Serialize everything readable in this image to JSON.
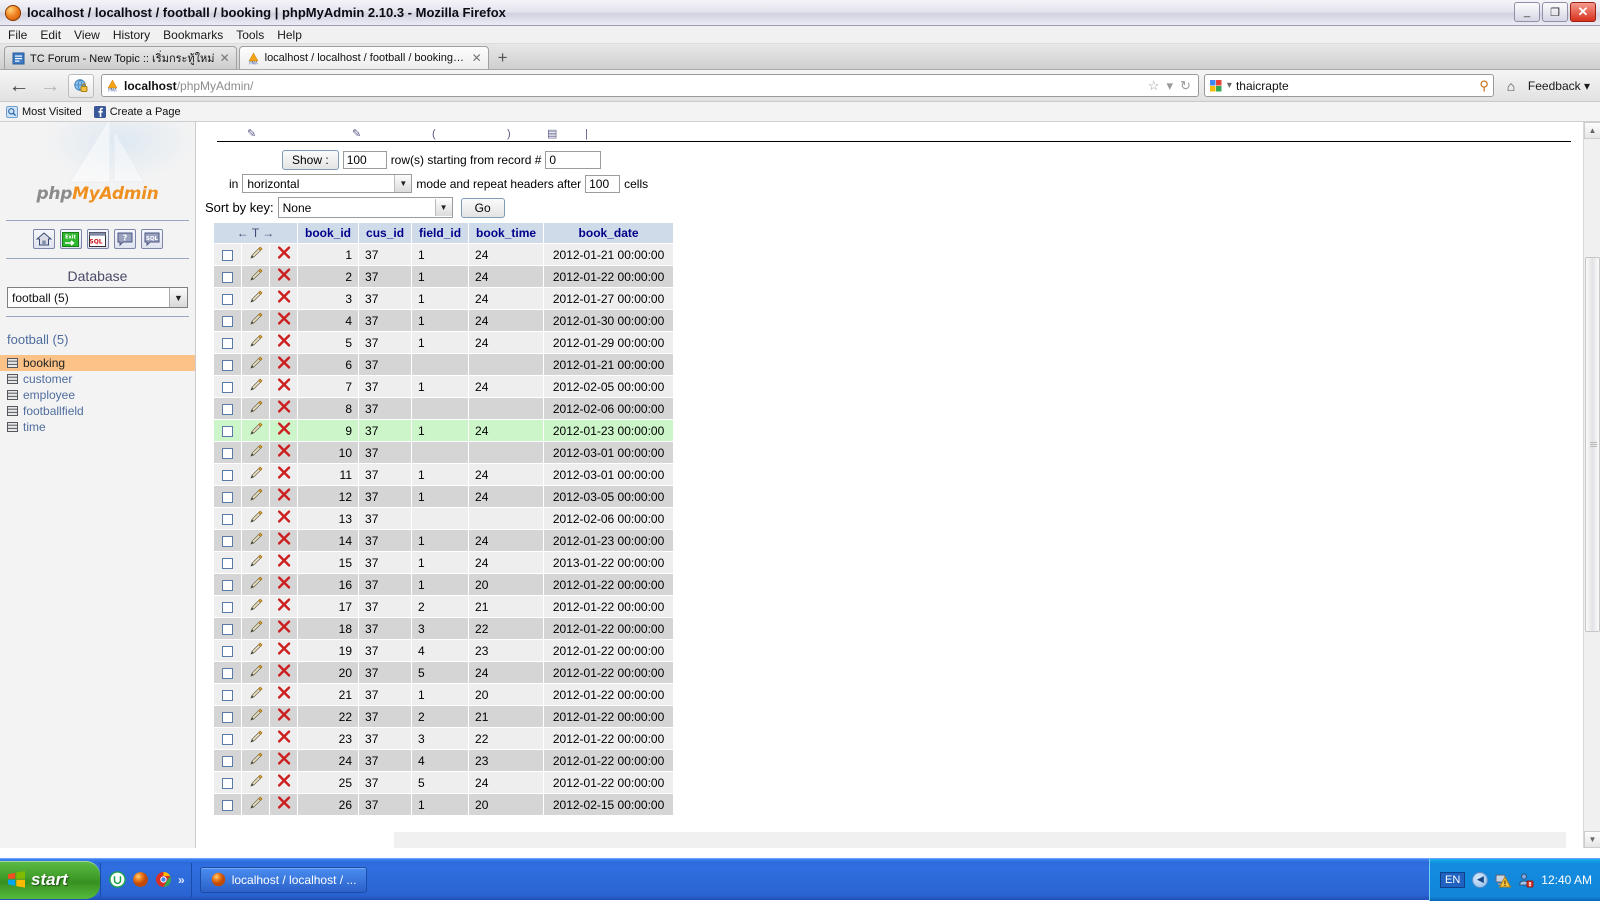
{
  "window": {
    "title": "localhost / localhost / football / booking | phpMyAdmin 2.10.3 - Mozilla Firefox",
    "minimize_label": "_",
    "restore_label": "❐",
    "close_label": "✕"
  },
  "menu": {
    "items": [
      "File",
      "Edit",
      "View",
      "History",
      "Bookmarks",
      "Tools",
      "Help"
    ]
  },
  "tabs": [
    {
      "label": "TC Forum - New Topic :: เริ่มกระทู้ใหม่",
      "close": "✕",
      "icon": "forum-favicon",
      "active": false
    },
    {
      "label": "localhost / localhost / football / booking | ...",
      "close": "✕",
      "icon": "phpmyadmin-favicon",
      "active": true
    }
  ],
  "newtab_label": "+",
  "nav": {
    "back_icon": "←",
    "forward_icon": "→",
    "url_bold": "localhost",
    "url_rest": "/phpMyAdmin/",
    "star_icon": "☆",
    "dropdown_icon": "▾",
    "reload_icon": "↻",
    "search_value": "thaicrapte",
    "search_dropdown": "▾",
    "search_icon": "⚲",
    "home_icon": "⌂",
    "feedback_label": "Feedback",
    "feedback_arrow": "▾"
  },
  "bookmarks": [
    {
      "label": "Most Visited",
      "icon": "most-visited-icon"
    },
    {
      "label": "Create a Page",
      "icon": "facebook-icon"
    }
  ],
  "pma": {
    "logo_php": "php",
    "logo_myadmin": "MyAdmin",
    "icons": [
      {
        "name": "home-icon",
        "glyph": "⌂"
      },
      {
        "name": "exit-icon",
        "glyph": "Exit"
      },
      {
        "name": "sql-query-window-icon",
        "glyph": "SQL"
      },
      {
        "name": "help-icon",
        "glyph": "?"
      },
      {
        "name": "sql-icon",
        "glyph": "SQL"
      }
    ],
    "database_heading": "Database",
    "database_selected": "football (5)",
    "database_name": "football (5)",
    "tables": [
      {
        "label": "booking",
        "selected": true
      },
      {
        "label": "customer",
        "selected": false
      },
      {
        "label": "employee",
        "selected": false
      },
      {
        "label": "footballfield",
        "selected": false
      },
      {
        "label": "time",
        "selected": false
      }
    ]
  },
  "form": {
    "show_button": "Show :",
    "rows_value": "100",
    "rows_label": "row(s) starting from record #",
    "record_value": "0",
    "in_label": "in",
    "mode_value": "horizontal",
    "mode_label": "mode and repeat headers after",
    "headers_value": "100",
    "cells_label": "cells",
    "sort_label": "Sort by key:",
    "sort_value": "None",
    "go_button": "Go"
  },
  "table": {
    "action_header": "← T →",
    "columns": [
      "book_id",
      "cus_id",
      "field_id",
      "book_time",
      "book_date"
    ],
    "rows": [
      {
        "book_id": "1",
        "cus_id": "37",
        "field_id": "1",
        "book_time": "24",
        "book_date": "2012-01-21 00:00:00"
      },
      {
        "book_id": "2",
        "cus_id": "37",
        "field_id": "1",
        "book_time": "24",
        "book_date": "2012-01-22 00:00:00"
      },
      {
        "book_id": "3",
        "cus_id": "37",
        "field_id": "1",
        "book_time": "24",
        "book_date": "2012-01-27 00:00:00"
      },
      {
        "book_id": "4",
        "cus_id": "37",
        "field_id": "1",
        "book_time": "24",
        "book_date": "2012-01-30 00:00:00"
      },
      {
        "book_id": "5",
        "cus_id": "37",
        "field_id": "1",
        "book_time": "24",
        "book_date": "2012-01-29 00:00:00"
      },
      {
        "book_id": "6",
        "cus_id": "37",
        "field_id": "",
        "book_time": "",
        "book_date": "2012-01-21 00:00:00"
      },
      {
        "book_id": "7",
        "cus_id": "37",
        "field_id": "1",
        "book_time": "24",
        "book_date": "2012-02-05 00:00:00"
      },
      {
        "book_id": "8",
        "cus_id": "37",
        "field_id": "",
        "book_time": "",
        "book_date": "2012-02-06 00:00:00"
      },
      {
        "book_id": "9",
        "cus_id": "37",
        "field_id": "1",
        "book_time": "24",
        "book_date": "2012-01-23 00:00:00"
      },
      {
        "book_id": "10",
        "cus_id": "37",
        "field_id": "",
        "book_time": "",
        "book_date": "2012-03-01 00:00:00"
      },
      {
        "book_id": "11",
        "cus_id": "37",
        "field_id": "1",
        "book_time": "24",
        "book_date": "2012-03-01 00:00:00"
      },
      {
        "book_id": "12",
        "cus_id": "37",
        "field_id": "1",
        "book_time": "24",
        "book_date": "2012-03-05 00:00:00"
      },
      {
        "book_id": "13",
        "cus_id": "37",
        "field_id": "",
        "book_time": "",
        "book_date": "2012-02-06 00:00:00"
      },
      {
        "book_id": "14",
        "cus_id": "37",
        "field_id": "1",
        "book_time": "24",
        "book_date": "2012-01-23 00:00:00"
      },
      {
        "book_id": "15",
        "cus_id": "37",
        "field_id": "1",
        "book_time": "24",
        "book_date": "2013-01-22 00:00:00"
      },
      {
        "book_id": "16",
        "cus_id": "37",
        "field_id": "1",
        "book_time": "20",
        "book_date": "2012-01-22 00:00:00"
      },
      {
        "book_id": "17",
        "cus_id": "37",
        "field_id": "2",
        "book_time": "21",
        "book_date": "2012-01-22 00:00:00"
      },
      {
        "book_id": "18",
        "cus_id": "37",
        "field_id": "3",
        "book_time": "22",
        "book_date": "2012-01-22 00:00:00"
      },
      {
        "book_id": "19",
        "cus_id": "37",
        "field_id": "4",
        "book_time": "23",
        "book_date": "2012-01-22 00:00:00"
      },
      {
        "book_id": "20",
        "cus_id": "37",
        "field_id": "5",
        "book_time": "24",
        "book_date": "2012-01-22 00:00:00"
      },
      {
        "book_id": "21",
        "cus_id": "37",
        "field_id": "1",
        "book_time": "20",
        "book_date": "2012-01-22 00:00:00"
      },
      {
        "book_id": "22",
        "cus_id": "37",
        "field_id": "2",
        "book_time": "21",
        "book_date": "2012-01-22 00:00:00"
      },
      {
        "book_id": "23",
        "cus_id": "37",
        "field_id": "3",
        "book_time": "22",
        "book_date": "2012-01-22 00:00:00"
      },
      {
        "book_id": "24",
        "cus_id": "37",
        "field_id": "4",
        "book_time": "23",
        "book_date": "2012-01-22 00:00:00"
      },
      {
        "book_id": "25",
        "cus_id": "37",
        "field_id": "5",
        "book_time": "24",
        "book_date": "2012-01-22 00:00:00"
      },
      {
        "book_id": "26",
        "cus_id": "37",
        "field_id": "1",
        "book_time": "20",
        "book_date": "2012-02-15 00:00:00"
      }
    ],
    "hover_row_index": 8
  },
  "taskbar": {
    "start_label": "start",
    "quicklaunch_chevron": "»",
    "task_label": "localhost / localhost / ...",
    "language": "EN",
    "collapse_icon": "◀",
    "clock": "12:40 AM"
  },
  "colors": {
    "accent": "#00008b",
    "header_bg": "#cfdbe8",
    "row_odd": "#eeeeee",
    "row_even": "#d5d5d5",
    "row_hover": "#cdf5ca",
    "selected_table": "#fcc287",
    "link": "#4f6d9e"
  }
}
